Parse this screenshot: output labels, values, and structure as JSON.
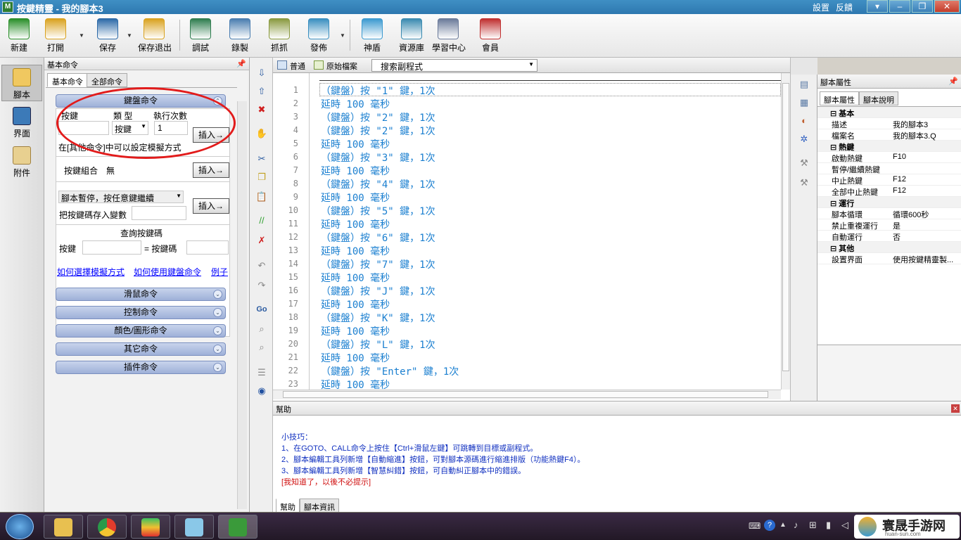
{
  "window": {
    "title": "按鍵精靈 - 我的腳本3",
    "links": [
      "設置",
      "反饋"
    ]
  },
  "toolbar": {
    "items": [
      {
        "label": "新建",
        "icon": "new-file-icon",
        "color": "#2a8f2a"
      },
      {
        "label": "打開",
        "icon": "open-folder-icon",
        "color": "#d9a21f"
      },
      {
        "label": "保存",
        "icon": "save-disk-icon",
        "color": "#2d6aa8"
      },
      {
        "label": "保存退出",
        "icon": "save-exit-icon",
        "color": "#d9a21f"
      },
      {
        "label": "調試",
        "icon": "debug-icon",
        "color": "#2f7d4f"
      },
      {
        "label": "錄製",
        "icon": "record-camera-icon",
        "color": "#4a7db0"
      },
      {
        "label": "抓抓",
        "icon": "grab-hand-icon",
        "color": "#8a9a40"
      },
      {
        "label": "發佈",
        "icon": "publish-globe-icon",
        "color": "#3a8fc0"
      },
      {
        "label": "神盾",
        "icon": "shield-icon",
        "color": "#3c9ad0"
      },
      {
        "label": "資源庫",
        "icon": "resource-icon",
        "color": "#3a8ab0"
      },
      {
        "label": "學習中心",
        "icon": "learning-book-icon",
        "color": "#6a7a9a"
      },
      {
        "label": "會員",
        "icon": "member-icon",
        "color": "#c03030"
      }
    ]
  },
  "leftbar": {
    "items": [
      {
        "label": "腳本",
        "icon": "script-icon"
      },
      {
        "label": "界面",
        "icon": "ui-icon"
      },
      {
        "label": "附件",
        "icon": "attachment-icon"
      }
    ]
  },
  "cmdpanel": {
    "header": "基本命令",
    "tabs": [
      "基本命令",
      "全部命令"
    ],
    "keyboard": {
      "section": "鍵盤命令",
      "col_key": "按鍵",
      "col_type": "類 型",
      "col_count": "執行次數",
      "type_value": "按鍵",
      "count_value": "1",
      "insert": "插入→",
      "note": "在[其他命令]中可以設定模擬方式",
      "combo_label": "按鍵組合",
      "combo_value": "無",
      "pause_select": "腳本暫停，按任意鍵繼續",
      "save_key": "把按鍵碼存入變數",
      "query_title": "查詢按鍵碼",
      "query_key": "按鍵",
      "query_code": "= 按鍵碼",
      "link1": "如何選擇模擬方式",
      "link2": "如何使用鍵盤命令",
      "link3": "例子"
    },
    "sections": [
      "滑鼠命令",
      "控制命令",
      "顏色/圖形命令",
      "其它命令",
      "插件命令"
    ]
  },
  "editor": {
    "tab_normal": "普通",
    "tab_source": "原始檔案",
    "search": "搜索副程式",
    "lines": [
      {
        "n": "1",
        "t": "（鍵盤）按 \"1\" 鍵，1次"
      },
      {
        "n": "2",
        "t": "延時 100 毫秒"
      },
      {
        "n": "3",
        "t": "（鍵盤）按 \"2\" 鍵，1次"
      },
      {
        "n": "4",
        "t": "（鍵盤）按 \"2\" 鍵，1次"
      },
      {
        "n": "5",
        "t": "延時 100 毫秒"
      },
      {
        "n": "6",
        "t": "（鍵盤）按 \"3\" 鍵，1次"
      },
      {
        "n": "7",
        "t": "延時 100 毫秒"
      },
      {
        "n": "8",
        "t": "（鍵盤）按 \"4\" 鍵，1次"
      },
      {
        "n": "9",
        "t": "延時 100 毫秒"
      },
      {
        "n": "10",
        "t": "（鍵盤）按 \"5\" 鍵，1次"
      },
      {
        "n": "11",
        "t": "延時 100 毫秒"
      },
      {
        "n": "12",
        "t": "（鍵盤）按 \"6\" 鍵，1次"
      },
      {
        "n": "13",
        "t": "延時 100 毫秒"
      },
      {
        "n": "14",
        "t": "（鍵盤）按 \"7\" 鍵，1次"
      },
      {
        "n": "15",
        "t": "延時 100 毫秒"
      },
      {
        "n": "16",
        "t": "（鍵盤）按 \"J\" 鍵，1次"
      },
      {
        "n": "17",
        "t": "延時 100 毫秒"
      },
      {
        "n": "18",
        "t": "（鍵盤）按 \"K\" 鍵，1次"
      },
      {
        "n": "19",
        "t": "延時 100 毫秒"
      },
      {
        "n": "20",
        "t": "（鍵盤）按 \"L\" 鍵，1次"
      },
      {
        "n": "21",
        "t": "延時 100 毫秒"
      },
      {
        "n": "22",
        "t": "（鍵盤）按 \"Enter\" 鍵，1次"
      },
      {
        "n": "23",
        "t": "延時 100 毫秒"
      }
    ]
  },
  "props": {
    "header": "腳本屬性",
    "tabs": [
      "腳本屬性",
      "腳本說明"
    ],
    "rows": [
      {
        "cat": true,
        "k": "基本",
        "v": ""
      },
      {
        "k": "描述",
        "v": "我的腳本3"
      },
      {
        "k": "檔案名",
        "v": "我的腳本3.Q"
      },
      {
        "cat": true,
        "k": "熱鍵",
        "v": ""
      },
      {
        "k": "啟動熱鍵",
        "v": "F10"
      },
      {
        "k": "暫停/繼續熱鍵",
        "v": ""
      },
      {
        "k": "中止熱鍵",
        "v": "F12"
      },
      {
        "k": "全部中止熱鍵",
        "v": "F12"
      },
      {
        "cat": true,
        "k": "運行",
        "v": ""
      },
      {
        "k": "腳本循環",
        "v": "循環600秒"
      },
      {
        "k": "禁止重複運行",
        "v": "是"
      },
      {
        "k": "自動運行",
        "v": "否"
      },
      {
        "cat": true,
        "k": "其他",
        "v": ""
      },
      {
        "k": "設置界面",
        "v": "使用按鍵精靈製..."
      }
    ]
  },
  "help": {
    "header": "幫助",
    "title": "小技巧：",
    "tip1": "1、在GOTO、CALL命令上按住【Ctrl+滑鼠左鍵】可跳轉到目標或副程式。",
    "tip2": "2、腳本編輯工具列新增【自動縮進】按鈕，可對腳本源碼進行縮進排版（功能熱鍵F4）。",
    "tip3": "3、腳本編輯工具列新增【智慧糾錯】按鈕，可自動糾正腳本中的錯誤。",
    "dismiss": "[我知道了，以後不必提示]",
    "tabs": [
      "幫助",
      "腳本資訊"
    ]
  },
  "watermark": {
    "text": "寰晟手游网",
    "sub": "huan-sun.com"
  },
  "colors": {
    "code": "#1a7fd0",
    "keyword": "#0050a0",
    "annotation": "#e21b1b",
    "help": "#1030c0"
  }
}
